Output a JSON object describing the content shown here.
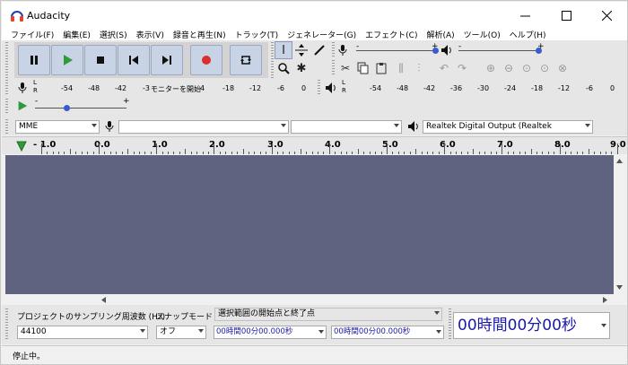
{
  "window": {
    "title": "Audacity"
  },
  "menu": [
    "ファイル(F)",
    "編集(E)",
    "選択(S)",
    "表示(V)",
    "録音と再生(N)",
    "トラック(T)",
    "ジェネレーター(G)",
    "エフェクト(C)",
    "解析(A)",
    "ツール(O)",
    "ヘルプ(H)"
  ],
  "meters": {
    "record_scale": [
      "-54",
      "-48",
      "-42",
      "-3",
      "モニターを開始",
      "4",
      "-18",
      "-12",
      "-6",
      "0"
    ],
    "play_scale": [
      "-54",
      "-48",
      "-42",
      "-36",
      "-30",
      "-24",
      "-18",
      "-12",
      "-6",
      "0"
    ],
    "lr_left": "L",
    "lr_right": "R"
  },
  "mixer": {
    "minus": "-",
    "plus": "+"
  },
  "devices": {
    "host": "MME",
    "recording_device": "",
    "recording_channels": "",
    "playback_device": "Realtek Digital Output (Realtek"
  },
  "ruler": {
    "labels": [
      "- 1.0",
      "0.0",
      "1.0",
      "2.0",
      "3.0",
      "4.0",
      "5.0",
      "6.0",
      "7.0",
      "8.0",
      "9.0"
    ]
  },
  "selection": {
    "rate_label": "プロジェクトのサンプリング周波数 (Hz)",
    "snap_label": "スナップモード",
    "range_label": "選択範囲の開始点と終了点",
    "rate_value": "44100",
    "snap_value": "オフ",
    "start_time": "00時間00分00.000秒",
    "end_time": "00時間00分00.000秒",
    "audio_position": "00時間00分00秒"
  },
  "status": {
    "text": "停止中。"
  },
  "colors": {
    "accent": "#3a5bd0",
    "track_bg": "#5f6380",
    "button_face": "#c8d3e6",
    "record_red": "#d9302e",
    "play_green": "#2e9b3a"
  }
}
